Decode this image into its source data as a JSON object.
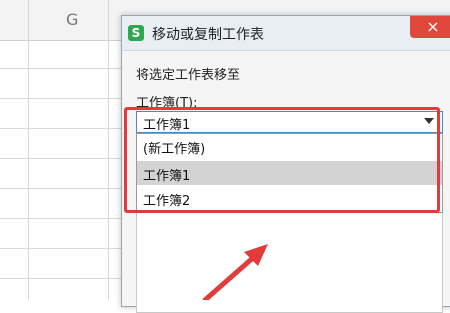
{
  "sheet": {
    "column_label": "G"
  },
  "dialog": {
    "app_icon": "S",
    "title": "移动或复制工作表",
    "close_glyph": "×",
    "move_label": "将选定工作表移至",
    "workbook_label": "工作簿(T):",
    "selected_workbook": "工作簿1",
    "options": [
      "(新工作簿)",
      "工作簿1",
      "工作簿2"
    ],
    "highlighted_option_index": 1
  },
  "annotation": {
    "color": "#e23b3b"
  }
}
